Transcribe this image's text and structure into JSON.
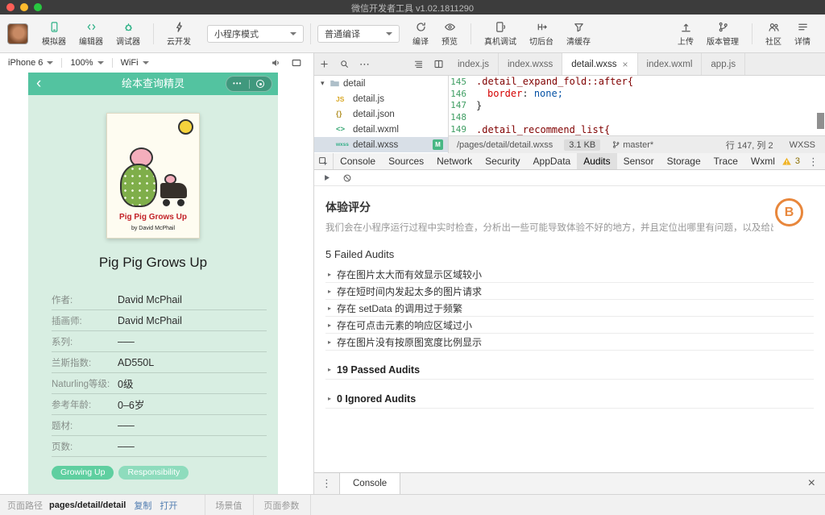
{
  "icons": {
    "tree_caret": "▾",
    "expand_triangle": "▸",
    "more_dots": "⋯",
    "kebab": "⋮",
    "close": "×",
    "back_chevron": "‹",
    "capsule_dots": "•••"
  },
  "titlebar": {
    "title": "微信开发者工具 v1.02.1811290"
  },
  "toolbar": {
    "simulator": "模拟器",
    "editor": "编辑器",
    "debugger": "调试器",
    "cloud": "云开发",
    "mode": "小程序模式",
    "compile_mode": "普通编译",
    "compile": "编译",
    "preview": "预览",
    "real_device": "真机调试",
    "to_background": "切后台",
    "clear_cache": "清缓存",
    "upload": "上传",
    "version": "版本管理",
    "community": "社区",
    "details": "详情"
  },
  "simulator": {
    "device": "iPhone 6",
    "zoom": "100%",
    "network": "WiFi"
  },
  "miniapp": {
    "nav_title": "绘本查询精灵",
    "cover_title": "Pig Pig Grows Up",
    "cover_byline": "by David McPhail",
    "book_title": "Pig Pig Grows Up",
    "fields": [
      {
        "label": "作者:",
        "value": "David McPhail"
      },
      {
        "label": "插画师:",
        "value": "David McPhail"
      },
      {
        "label": "系列:",
        "value": "–––"
      },
      {
        "label": "兰斯指数:",
        "value": "AD550L"
      },
      {
        "label": "Naturling等级:",
        "value": "0级"
      },
      {
        "label": "参考年龄:",
        "value": "0–6岁"
      },
      {
        "label": "题材:",
        "value": "–––"
      },
      {
        "label": "页数:",
        "value": "–––"
      }
    ],
    "tags": [
      "Growing Up",
      "Responsibility"
    ]
  },
  "editor": {
    "tabs": [
      "index.js",
      "index.wxss",
      "detail.wxss",
      "index.wxml",
      "app.js"
    ],
    "tree": {
      "folder": "detail",
      "files": [
        {
          "name": "detail.js",
          "type": "JS"
        },
        {
          "name": "detail.json",
          "type": "{}"
        },
        {
          "name": "detail.wxml",
          "type": "<>"
        },
        {
          "name": "detail.wxss",
          "type": "wxss",
          "badge": "M"
        }
      ]
    },
    "code": {
      "nums": [
        "145",
        "146",
        "147",
        "148",
        "149"
      ],
      "l145": ".detail_expand_fold::after{",
      "l146_prop": "border",
      "l146_sep": ": ",
      "l146_val": "none;",
      "l147": "}",
      "l148": "",
      "l149": ".detail_recommend_list{"
    },
    "status": {
      "path": "/pages/detail/detail.wxss",
      "size": "3.1 KB",
      "branch": "master*",
      "cursor": "行 147, 列 2",
      "lang": "WXSS"
    }
  },
  "devtools": {
    "tabs": [
      "Console",
      "Sources",
      "Network",
      "Security",
      "AppData",
      "Audits",
      "Sensor",
      "Storage",
      "Trace",
      "Wxml"
    ],
    "warning_count": "3",
    "audits": {
      "title": "体验评分",
      "description": "我们会在小程序运行过程中实时检查，分析出一些可能导致体验不好的地方，并且定位出哪里有问题，以及给出一些优化建议",
      "score": "B",
      "failed_header": "5 Failed Audits",
      "failed_items": [
        "存在图片太大而有效显示区域较小",
        "存在短时间内发起太多的图片请求",
        "存在 setData 的调用过于频繁",
        "存在可点击元素的响应区域过小",
        "存在图片没有按原图宽度比例显示"
      ],
      "passed_header": "19 Passed Audits",
      "ignored_header": "0 Ignored Audits"
    },
    "drawer": {
      "console_tab": "Console"
    }
  },
  "statusbar": {
    "page_path_label": "页面路径",
    "page_path": "pages/detail/detail",
    "copy": "复制",
    "open": "打开",
    "scene_label": "场景值",
    "params_label": "页面参数"
  }
}
